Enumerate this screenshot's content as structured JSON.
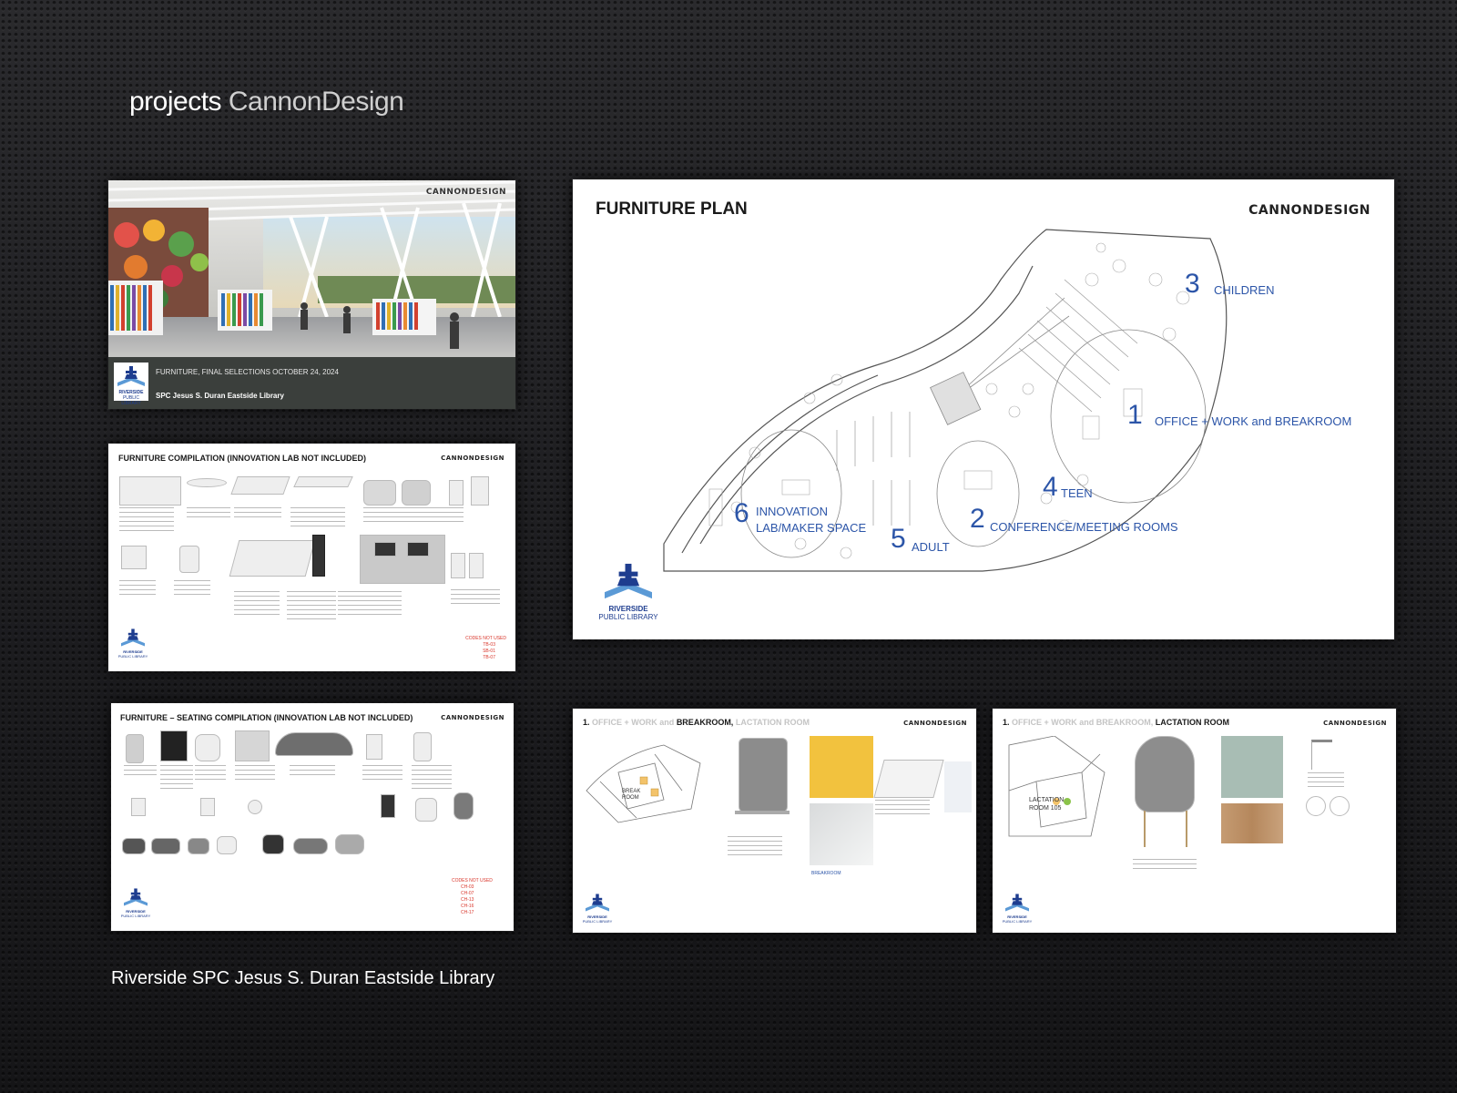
{
  "heading": {
    "bold": "projects",
    "light": "CannonDesign"
  },
  "caption": "Riverside SPC Jesus S. Duran Eastside Library",
  "brand": "CANNONDESIGN",
  "logo": {
    "line1": "RIVERSIDE",
    "line2": "PUBLIC LIBRARY"
  },
  "cover": {
    "subtitle": "FURNITURE, FINAL SELECTIONS OCTOBER 24, 2024",
    "title": "SPC Jesus S. Duran Eastside Library"
  },
  "compilation": {
    "title": "FURNITURE COMPILATION (INNOVATION LAB NOT INCLUDED)",
    "codes_label": "CODES NOT USED",
    "codes": [
      "TB-03",
      "SB-01",
      "TB-07"
    ]
  },
  "seating": {
    "title": "FURNITURE – SEATING COMPILATION (INNOVATION LAB NOT INCLUDED)",
    "codes_label": "CODES NOT USED",
    "codes": [
      "CH-03",
      "CH-07",
      "CH-13",
      "CH-16",
      "CH-17"
    ]
  },
  "plan": {
    "title": "FURNITURE PLAN",
    "rooms": [
      {
        "num": "3",
        "label": "CHILDREN"
      },
      {
        "num": "1",
        "label": "OFFICE + WORK and BREAKROOM"
      },
      {
        "num": "4",
        "label": "TEEN"
      },
      {
        "num": "6",
        "label": "INNOVATION",
        "label2": "LAB/MAKER SPACE"
      },
      {
        "num": "5",
        "label": "ADULT"
      },
      {
        "num": "2",
        "label": "CONFERENCE/MEETING ROOMS"
      }
    ]
  },
  "breakroom": {
    "num": "1.",
    "gray1": "OFFICE + WORK and",
    "bold": "BREAKROOM,",
    "gray2": "LACTATION ROOM",
    "plan_label": "BREAK ROOM",
    "link": "BREAKROOM"
  },
  "lactation": {
    "num": "1.",
    "gray": "OFFICE + WORK and BREAKROOM,",
    "bold": "LACTATION ROOM",
    "plan_label": "LACTATION ROOM 105"
  }
}
